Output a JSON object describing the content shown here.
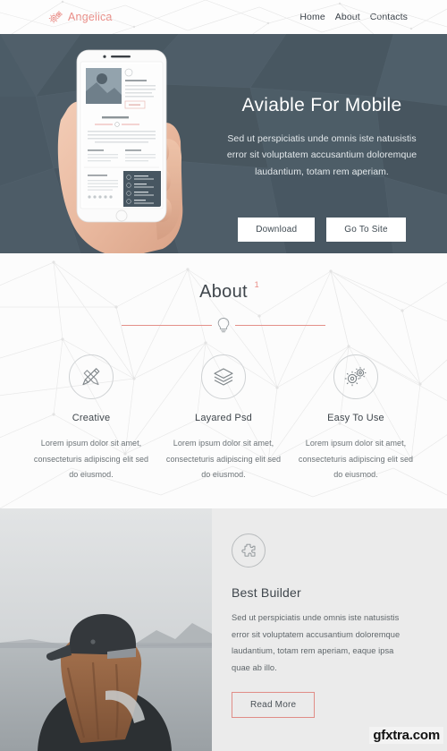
{
  "header": {
    "logo_text": "Angelica",
    "logo_icon": "gears-icon",
    "nav": [
      {
        "label": "Home",
        "name": "nav-home"
      },
      {
        "label": "About",
        "name": "nav-about"
      },
      {
        "label": "Contacts",
        "name": "nav-contacts"
      }
    ]
  },
  "hero": {
    "title": "Aviable For Mobile",
    "subtitle": "Sed ut perspiciatis unde omnis iste natusistis error sit voluptatem accusantium doloremque laudantium, totam rem aperiam.",
    "buttons": [
      {
        "label": "Download",
        "name": "download-button"
      },
      {
        "label": "Go To Site",
        "name": "go-to-site-button"
      }
    ],
    "device_image_alt": "hand-holding-smartphone",
    "background_color": "#4c5c67"
  },
  "about": {
    "title": "About",
    "superscript": "1",
    "divider_icon": "lightbulb-icon",
    "accent_color": "#e49089",
    "features": [
      {
        "icon": "pencil-ruler-icon",
        "title": "Creative",
        "text": "Lorem ipsum dolor sit amet, consecteturis adipiscing elit sed do  eiusmod."
      },
      {
        "icon": "layers-icon",
        "title": "Layared Psd",
        "text": "Lorem ipsum dolor sit amet, consecteturis adipiscing elit sed do eiusmod."
      },
      {
        "icon": "gears-icon",
        "title": "Easy To Use",
        "text": "Lorem ipsum dolor sit amet, consecteturis adipiscing elit sed do eiusmod."
      }
    ]
  },
  "builder": {
    "icon": "puzzle-piece-icon",
    "title": "Best Builder",
    "text": "Sed ut perspiciatis unde omnis iste natusistis error sit voluptatem accusantium doloremque laudantium, totam rem aperiam, eaque ipsa quae ab illo.",
    "button_label": "Read More",
    "button_border_color": "#e08d87",
    "photo_alt": "woman-in-cap-by-the-water"
  },
  "watermark": {
    "text": "gfxtra.com"
  }
}
